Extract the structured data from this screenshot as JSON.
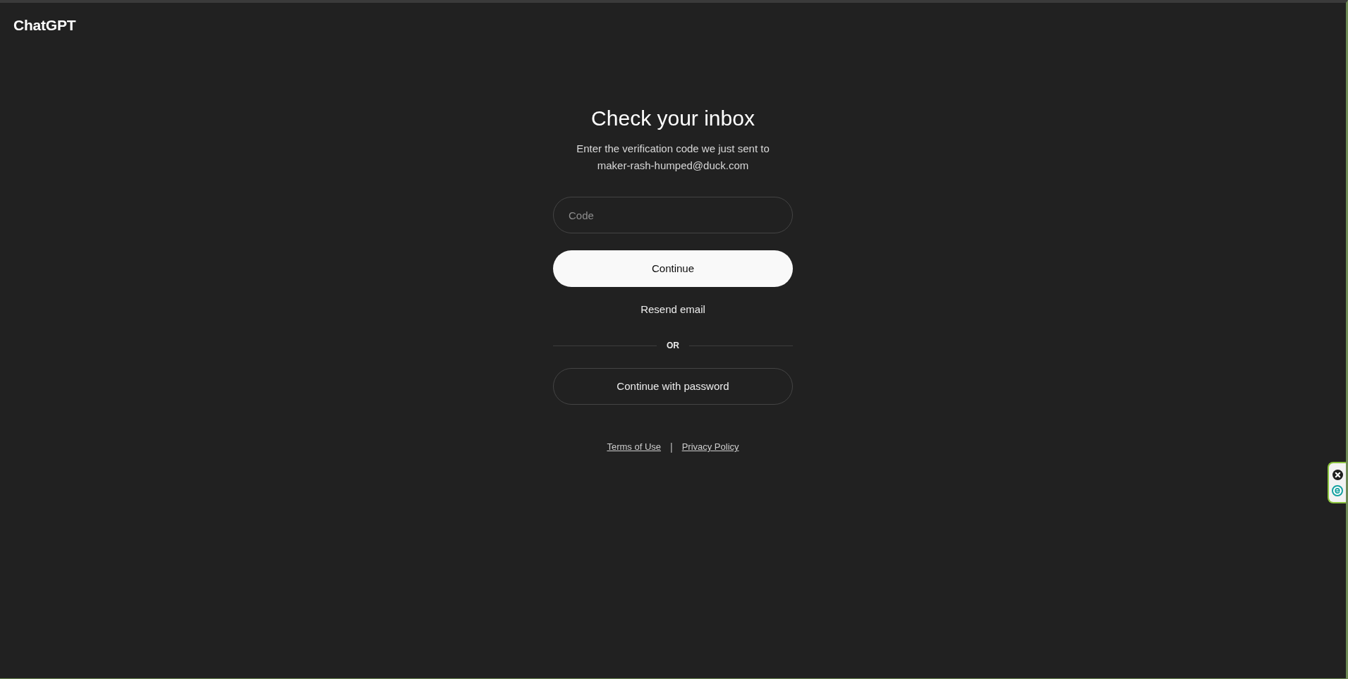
{
  "logo": {
    "text": "ChatGPT"
  },
  "heading": "Check your inbox",
  "instructions": "Enter the verification code we just sent to maker-rash-humped@duck.com",
  "code_field": {
    "placeholder": "Code"
  },
  "actions": [
    {
      "kind": "primary",
      "label": "Continue"
    },
    {
      "kind": "link",
      "label": "Resend email"
    },
    {
      "kind": "divider",
      "label": "OR"
    },
    {
      "kind": "outline",
      "label": "Continue with password"
    }
  ],
  "footer": {
    "links": [
      "Terms of Use",
      "Privacy Policy"
    ],
    "separator": "|"
  }
}
